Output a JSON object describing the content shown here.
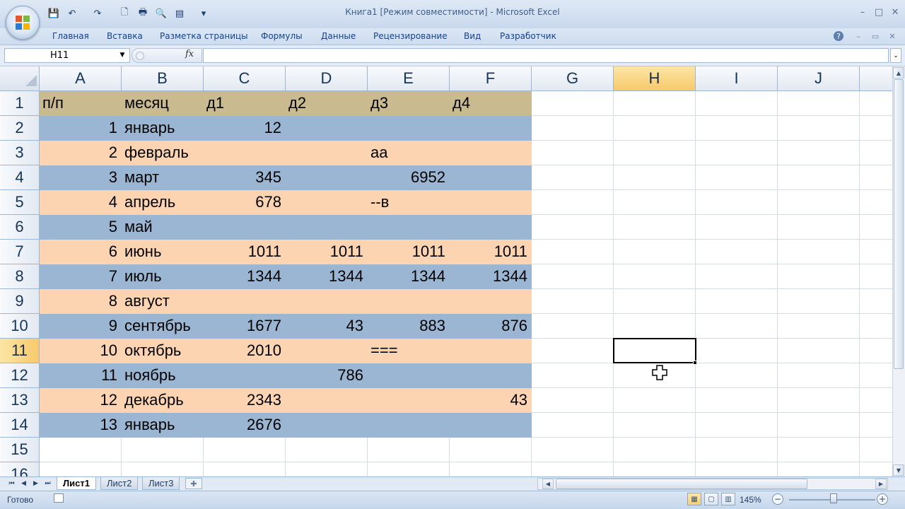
{
  "window": {
    "title": "Книга1  [Режим совместимости] - Microsoft Excel",
    "controls": [
      "–",
      "□",
      "✕"
    ]
  },
  "quick_access": {
    "save": "💾",
    "undo": "↶",
    "redo": "↷",
    "new": "🗋",
    "print": "🖶",
    "preview": "🔍",
    "form": "▤",
    "customize": "▾"
  },
  "ribbon": {
    "tabs": [
      "Главная",
      "Вставка",
      "Разметка страницы",
      "Формулы",
      "Данные",
      "Рецензирование",
      "Вид",
      "Разработчик"
    ],
    "help": "?",
    "controls": [
      "–",
      "▭",
      "✕"
    ]
  },
  "formula_bar": {
    "name_box": "H11",
    "fx_label": "fx",
    "value": ""
  },
  "grid": {
    "columns": [
      "A",
      "B",
      "C",
      "D",
      "E",
      "F",
      "G",
      "H",
      "I",
      "J",
      "K"
    ],
    "selected_column": "H",
    "rows": [
      "1",
      "2",
      "3",
      "4",
      "5",
      "6",
      "7",
      "8",
      "9",
      "10",
      "11",
      "12",
      "13",
      "14",
      "15",
      "16"
    ],
    "selected_row": "11",
    "active_cell": "H11",
    "cells": {
      "A1": "п/п",
      "B1": "месяц",
      "C1": "д1",
      "D1": "д2",
      "E1": "д3",
      "F1": "д4",
      "A2": "1",
      "B2": "январь",
      "C2": "12",
      "A3": "2",
      "B3": "февраль",
      "E3": "аа",
      "A4": "3",
      "B4": "март",
      "C4": "345",
      "E4": "6952",
      "A5": "4",
      "B5": "апрель",
      "C5": "678",
      "E5": "--в",
      "A6": "5",
      "B6": "май",
      "A7": "6",
      "B7": "июнь",
      "C7": "1011",
      "D7": "1011",
      "E7": "1011",
      "F7": "1011",
      "A8": "7",
      "B8": "июль",
      "C8": "1344",
      "D8": "1344",
      "E8": "1344",
      "F8": "1344",
      "A9": "8",
      "B9": "август",
      "A10": "9",
      "B10": "сентябрь",
      "C10": "1677",
      "D10": "43",
      "E10": "883",
      "F10": "876",
      "A11": "10",
      "B11": "октябрь",
      "C11": "2010",
      "E11": "===",
      "A12": "11",
      "B12": "ноябрь",
      "D12": "786",
      "A13": "12",
      "B13": "декабрь",
      "C13": "2343",
      "F13": "43",
      "A14": "13",
      "B14": "январь",
      "C14": "2676"
    },
    "colors": {
      "header_band": "#c9bb8f",
      "blue_band": "#9ab6d2",
      "peach_band": "#fcd4b1",
      "selected_header": "#f7c96a"
    }
  },
  "sheet_tabs": {
    "nav": [
      "⏮",
      "◀",
      "▶",
      "⏭"
    ],
    "tabs": [
      "Лист1",
      "Лист2",
      "Лист3"
    ],
    "active": "Лист1"
  },
  "status_bar": {
    "status": "Готово",
    "zoom": "145%",
    "zoom_minus": "−",
    "zoom_plus": "+"
  }
}
